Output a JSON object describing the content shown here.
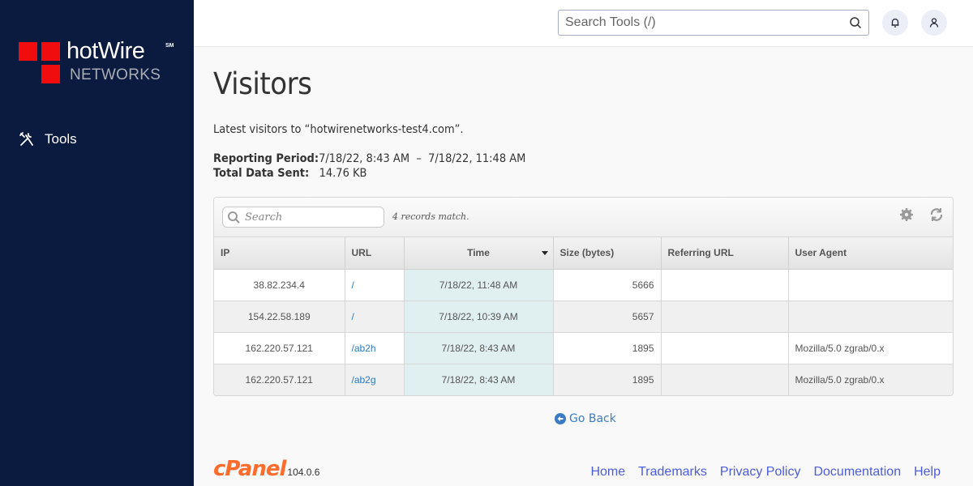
{
  "brand": {
    "name": "hotWire",
    "superscript": "SM",
    "subtitle": "NETWORKS"
  },
  "sidebar": {
    "items": [
      {
        "label": "Tools",
        "icon": "tools-icon"
      }
    ]
  },
  "topbar": {
    "search_placeholder": "Search Tools (/)",
    "search_value": ""
  },
  "page": {
    "title": "Visitors",
    "description": "Latest visitors to “hotwirenetworks-test4.com”.",
    "reporting_period_label": "Reporting Period:",
    "reporting_period_value": "7/18/22, 8:43 AM  –  7/18/22, 11:48 AM",
    "total_data_label": "Total Data Sent:",
    "total_data_value": "14.76 KB"
  },
  "table": {
    "search_placeholder": "Search",
    "search_value": "",
    "records_text": "4 records match.",
    "columns": [
      "IP",
      "URL",
      "Time",
      "Size (bytes)",
      "Referring URL",
      "User Agent"
    ],
    "sorted_column": "Time",
    "sort_direction": "desc",
    "rows": [
      {
        "ip": "38.82.234.4",
        "url": "/",
        "time": "7/18/22, 11:48 AM",
        "size": "5666",
        "referrer": "",
        "agent": ""
      },
      {
        "ip": "154.22.58.189",
        "url": "/",
        "time": "7/18/22, 10:39 AM",
        "size": "5657",
        "referrer": "",
        "agent": ""
      },
      {
        "ip": "162.220.57.121",
        "url": "/ab2h",
        "time": "7/18/22, 8:43 AM",
        "size": "1895",
        "referrer": "",
        "agent": "Mozilla/5.0 zgrab/0.x"
      },
      {
        "ip": "162.220.57.121",
        "url": "/ab2g",
        "time": "7/18/22, 8:43 AM",
        "size": "1895",
        "referrer": "",
        "agent": "Mozilla/5.0 zgrab/0.x"
      }
    ]
  },
  "go_back_label": "Go Back",
  "footer": {
    "logo_text": "cPanel",
    "version": "104.0.6",
    "links": [
      "Home",
      "Trademarks",
      "Privacy Policy",
      "Documentation",
      "Help"
    ]
  },
  "colors": {
    "sidebar_bg": "#0b1a3f",
    "logo_red": "#f10d0d",
    "link_blue": "#2c7bc4",
    "footer_link": "#4c5ce0",
    "cpanel_orange": "#ff6c2c",
    "sorted_col_bg": "#e0efef"
  }
}
